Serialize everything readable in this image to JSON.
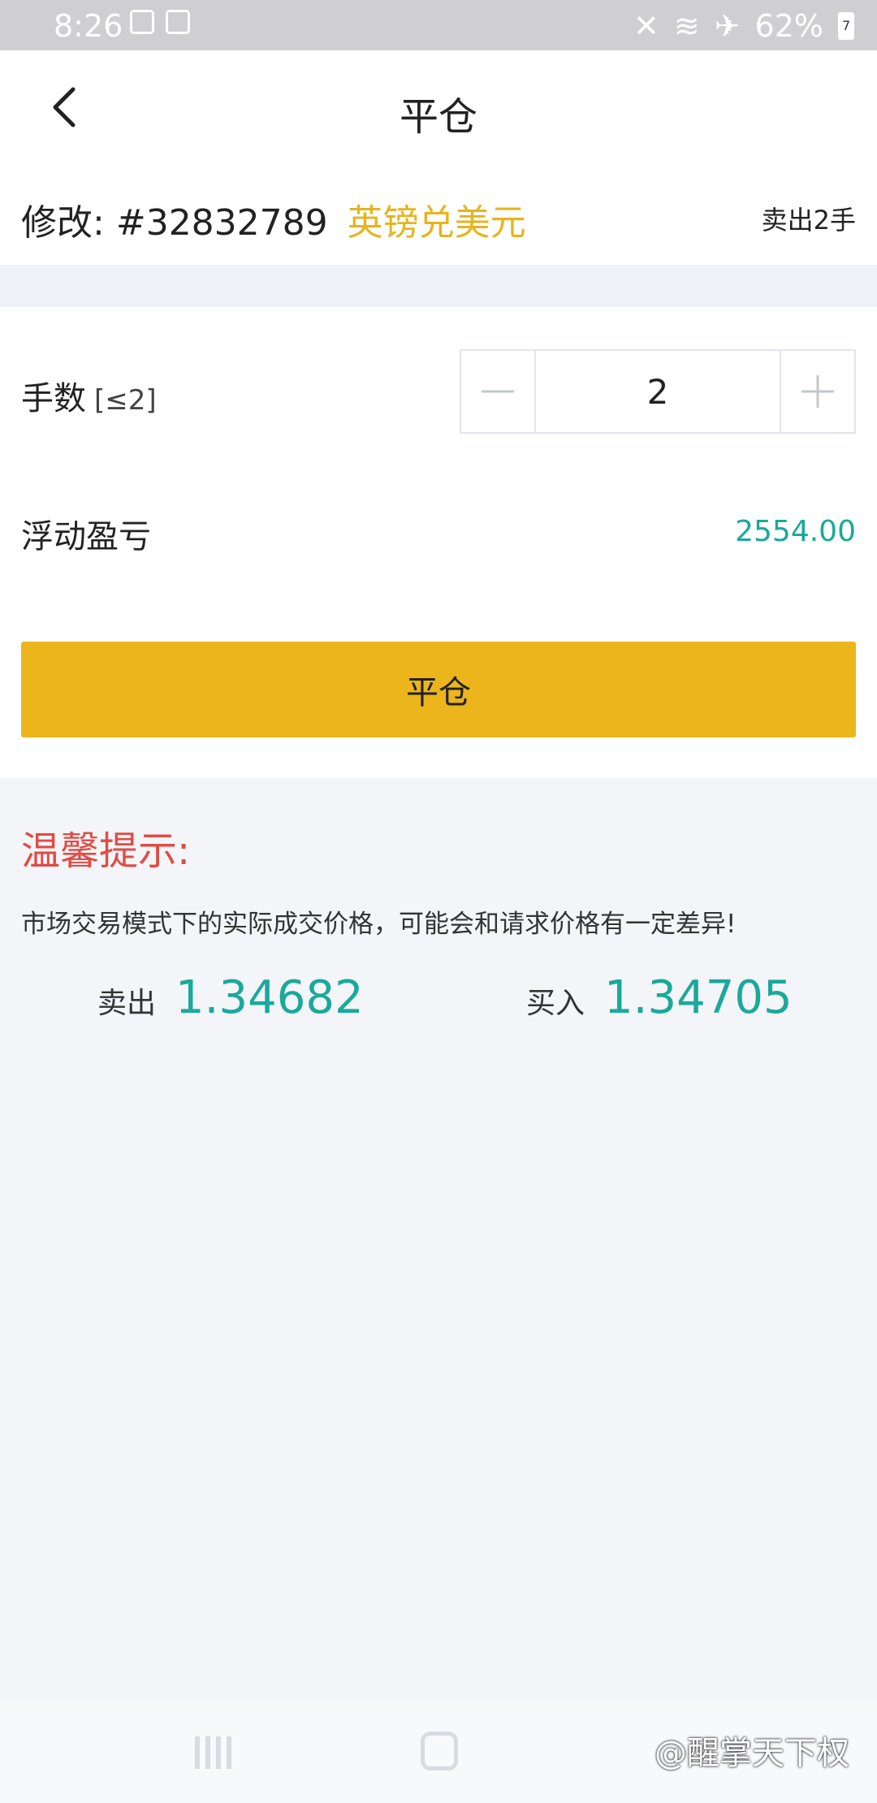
{
  "status_bar": {
    "time": "8:26",
    "battery": "62%",
    "battery_badge": "7",
    "icons": [
      "usb-icon",
      "notification-icon",
      "mute-icon",
      "wifi-icon",
      "airplane-icon",
      "battery-icon"
    ]
  },
  "header": {
    "title": "平仓",
    "back_icon": "chevron-left-icon"
  },
  "order": {
    "label": "修改:",
    "id": "#32832789",
    "symbol": "英镑兑美元",
    "side": "卖出2手"
  },
  "form": {
    "quantity_label": "手数",
    "quantity_limit": "[≤2]",
    "quantity_value": "2",
    "pnl_label": "浮动盈亏",
    "pnl_value": "2554.00",
    "submit_label": "平仓"
  },
  "tips": {
    "title": "温馨提示:",
    "text": "市场交易模式下的实际成交价格，可能会和请求价格有一定差异!"
  },
  "quotes": {
    "sell_label": "卖出",
    "sell_price": "1.34682",
    "buy_label": "买入",
    "buy_price": "1.34705"
  },
  "watermark": "@醒掌天下权",
  "colors": {
    "accent_yellow": "#ebb51b",
    "symbol_yellow": "#e6b41e",
    "price_green": "#1aa99a",
    "tips_red": "#e04c45",
    "page_bg": "#f3f5f9"
  }
}
